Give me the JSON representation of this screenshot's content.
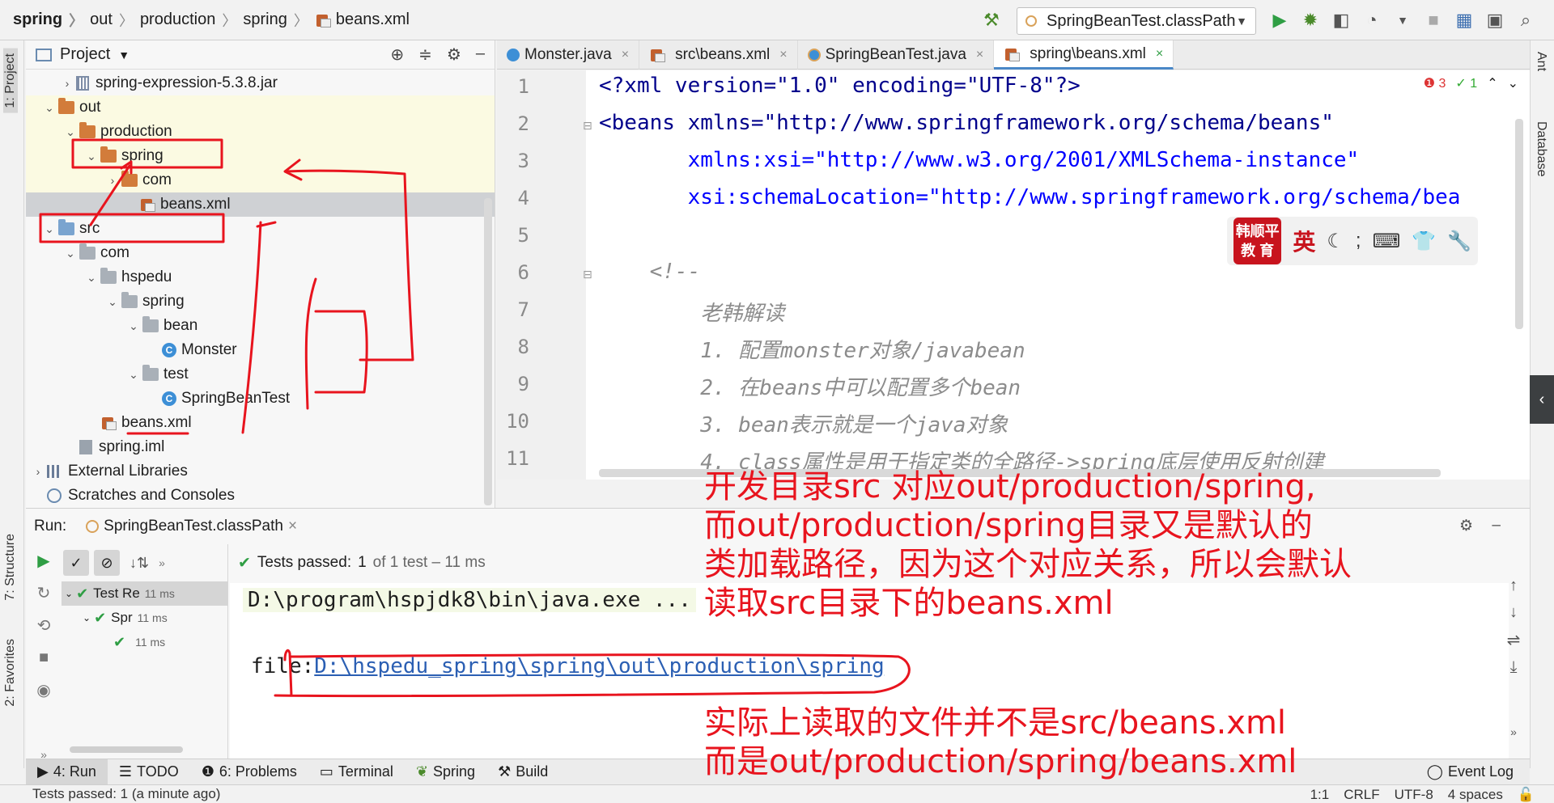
{
  "breadcrumbs": [
    "spring",
    "out",
    "production",
    "spring",
    "beans.xml"
  ],
  "run_config": {
    "label": "SpringBeanTest.classPath"
  },
  "left_tabs": [
    "1: Project",
    "7: Structure",
    "2: Favorites"
  ],
  "right_tabs": [
    "Ant",
    "Database"
  ],
  "project": {
    "header": "Project",
    "tree": [
      {
        "label": "spring-expression-5.3.8.jar",
        "icon": "jar",
        "chevron": "right"
      },
      {
        "label": "out",
        "icon": "folder-orange",
        "chevron": "down"
      },
      {
        "label": "production",
        "icon": "folder-orange",
        "chevron": "down"
      },
      {
        "label": "spring",
        "icon": "folder-orange",
        "chevron": "down"
      },
      {
        "label": "com",
        "icon": "folder-orange",
        "chevron": "right"
      },
      {
        "label": "beans.xml",
        "icon": "xml"
      },
      {
        "label": "src",
        "icon": "folder-blue",
        "chevron": "down"
      },
      {
        "label": "com",
        "icon": "folder-gray",
        "chevron": "down"
      },
      {
        "label": "hspedu",
        "icon": "folder-gray",
        "chevron": "down"
      },
      {
        "label": "spring",
        "icon": "folder-gray",
        "chevron": "down"
      },
      {
        "label": "bean",
        "icon": "folder-gray",
        "chevron": "down"
      },
      {
        "label": "Monster",
        "icon": "class"
      },
      {
        "label": "test",
        "icon": "folder-gray",
        "chevron": "down"
      },
      {
        "label": "SpringBeanTest",
        "icon": "class"
      },
      {
        "label": "beans.xml",
        "icon": "xml"
      },
      {
        "label": "spring.iml",
        "icon": "iml"
      },
      {
        "label": "External Libraries",
        "icon": "libs",
        "chevron": "right"
      },
      {
        "label": "Scratches and Consoles",
        "icon": "scratch"
      }
    ]
  },
  "editor_tabs": [
    {
      "label": "Monster.java",
      "active": false
    },
    {
      "label": "src\\beans.xml",
      "active": false
    },
    {
      "label": "SpringBeanTest.java",
      "active": false
    },
    {
      "label": "spring\\beans.xml",
      "active": true
    }
  ],
  "inspection": {
    "errors": "3",
    "warnings": "1"
  },
  "code_lines": [
    "<?xml version=\"1.0\" encoding=\"UTF-8\"?>",
    "<beans xmlns=\"http://www.springframework.org/schema/beans\"",
    "       xmlns:xsi=\"http://www.w3.org/2001/XMLSchema-instance\"",
    "       xsi:schemaLocation=\"http://www.springframework.org/schema/bea",
    "",
    "    <!--",
    "        老韩解读",
    "        1. 配置monster对象/javabean",
    "        2. 在beans中可以配置多个bean",
    "        3. bean表示就是一个java对象",
    "        4. class属性是用于指定类的全路径->spring底层使用反射创建"
  ],
  "ime": {
    "brand_line1": "韩顺平",
    "brand_line2": "教 育",
    "lang": "英"
  },
  "run": {
    "label": "Run:",
    "config": "SpringBeanTest.classPath",
    "status_prefix": "Tests passed:",
    "status_count": "1",
    "status_suffix": "of 1 test – 11 ms",
    "tree": [
      {
        "label": "Test Re",
        "time": "11 ms"
      },
      {
        "label": "Spr",
        "time": "11 ms"
      },
      {
        "label": "",
        "time": "11 ms"
      }
    ],
    "console_cmd": "D:\\program\\hspjdk8\\bin\\java.exe ...",
    "console_file_prefix": "file:",
    "console_file_path": "D:\\hspedu_spring\\spring\\out\\production\\spring"
  },
  "bottom_tabs": [
    {
      "label": "4: Run",
      "active": true
    },
    {
      "label": "TODO",
      "active": false
    },
    {
      "label": "6: Problems",
      "active": false
    },
    {
      "label": "Terminal",
      "active": false
    },
    {
      "label": "Spring",
      "active": false
    },
    {
      "label": "Build",
      "active": false
    }
  ],
  "event_log": "Event Log",
  "status_bar": {
    "message": "Tests passed: 1 (a minute ago)",
    "position": "1:1",
    "line_sep": "CRLF",
    "encoding": "UTF-8",
    "indent": "4 spaces"
  },
  "annotations": {
    "block1": [
      "开发目录src 对应out/production/spring,",
      "而out/production/spring目录又是默认的",
      "类加载路径，因为这个对应关系，所以会默认",
      "读取src目录下的beans.xml"
    ],
    "block2": [
      "实际上读取的文件并不是src/beans.xml",
      "而是out/production/spring/beans.xml"
    ]
  },
  "colors": {
    "annotation": "#e8141e",
    "accent": "#4a88c7",
    "ok": "#2f9e44"
  }
}
